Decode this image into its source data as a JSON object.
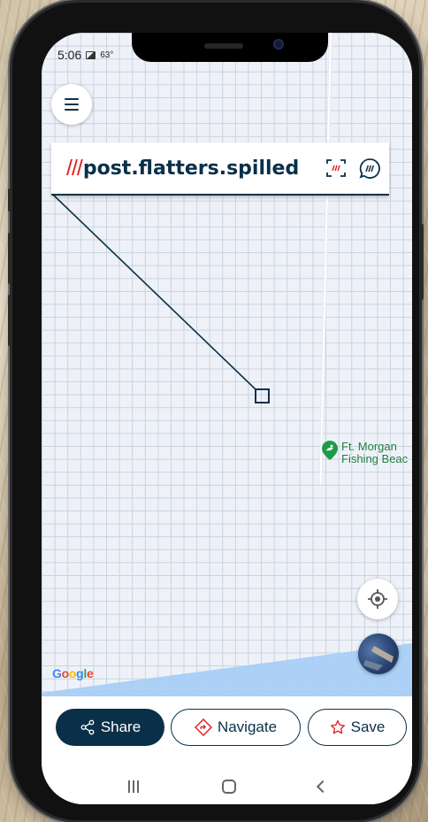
{
  "status_bar": {
    "time": "5:06",
    "temperature": "63°"
  },
  "header": {
    "menu_icon": "hamburger-icon",
    "slashes": "///",
    "address": "post.flatters.spilled",
    "scan_icon": "scan-icon",
    "chat_icon": "w3w-chat-icon"
  },
  "map": {
    "poi_label_line1": "Ft. Morgan",
    "poi_label_line2": "Fishing Beac",
    "poi_icon": "fishing-pin-icon",
    "attribution": "Google",
    "locate_icon": "locate-crosshair-icon",
    "layer_icon": "satellite-layer-thumbnail",
    "colors": {
      "grid": "#c9d2de",
      "water": "#a8cdf6",
      "poi": "#1f7a3d"
    }
  },
  "actions": {
    "share_label": "Share",
    "share_icon": "share-icon",
    "navigate_label": "Navigate",
    "navigate_icon": "directions-icon",
    "save_label": "Save",
    "save_icon": "star-outline-icon"
  },
  "system_nav": {
    "recent_icon": "recent-apps-icon",
    "home_icon": "home-icon",
    "back_icon": "back-icon"
  },
  "colors": {
    "brand_navy": "#0a3049",
    "brand_red": "#e11f26"
  }
}
